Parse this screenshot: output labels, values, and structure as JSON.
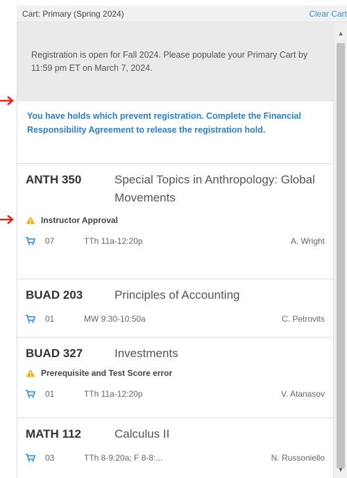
{
  "cart": {
    "title": "Cart: Primary (Spring 2024)",
    "clear_label": "Clear Cart"
  },
  "notice": {
    "text": "Registration is open for Fall 2024. Please populate your Primary Cart by 11:59 pm ET on March 7, 2024."
  },
  "holds": {
    "text": "You have holds which prevent registration. Complete the Financial Responsibility Agreement to release the registration hold."
  },
  "courses": [
    {
      "code": "ANTH 350",
      "name": "Special Topics in Anthropology: Global Movements",
      "alert": "Instructor Approval",
      "section": "07",
      "time": "TTh 11a-12:20p",
      "instructor": "A. Wright"
    },
    {
      "code": "BUAD 203",
      "name": "Principles of Accounting",
      "section": "01",
      "time": "MW 9:30-10:50a",
      "instructor": "C. Petrovits"
    },
    {
      "code": "BUAD 327",
      "name": "Investments",
      "alert": "Prerequisite and Test Score error",
      "section": "01",
      "time": "TTh 11a-12:20p",
      "instructor": "V. Atanasov"
    },
    {
      "code": "MATH 112",
      "name": "Calculus II",
      "section": "03",
      "time": "TTh 8-9:20a; F 8-8:...",
      "instructor": "N. Russoniello"
    }
  ],
  "colors": {
    "link": "#3b8fd6",
    "hold_text": "#2f7fc4",
    "warning": "#f2b01e",
    "cart_icon": "#2b86d9",
    "annotation_arrow": "#e3231b"
  },
  "icons": {
    "warning": "warning-triangle-icon",
    "cart": "shopping-cart-icon",
    "arrow": "red-arrow-icon"
  }
}
